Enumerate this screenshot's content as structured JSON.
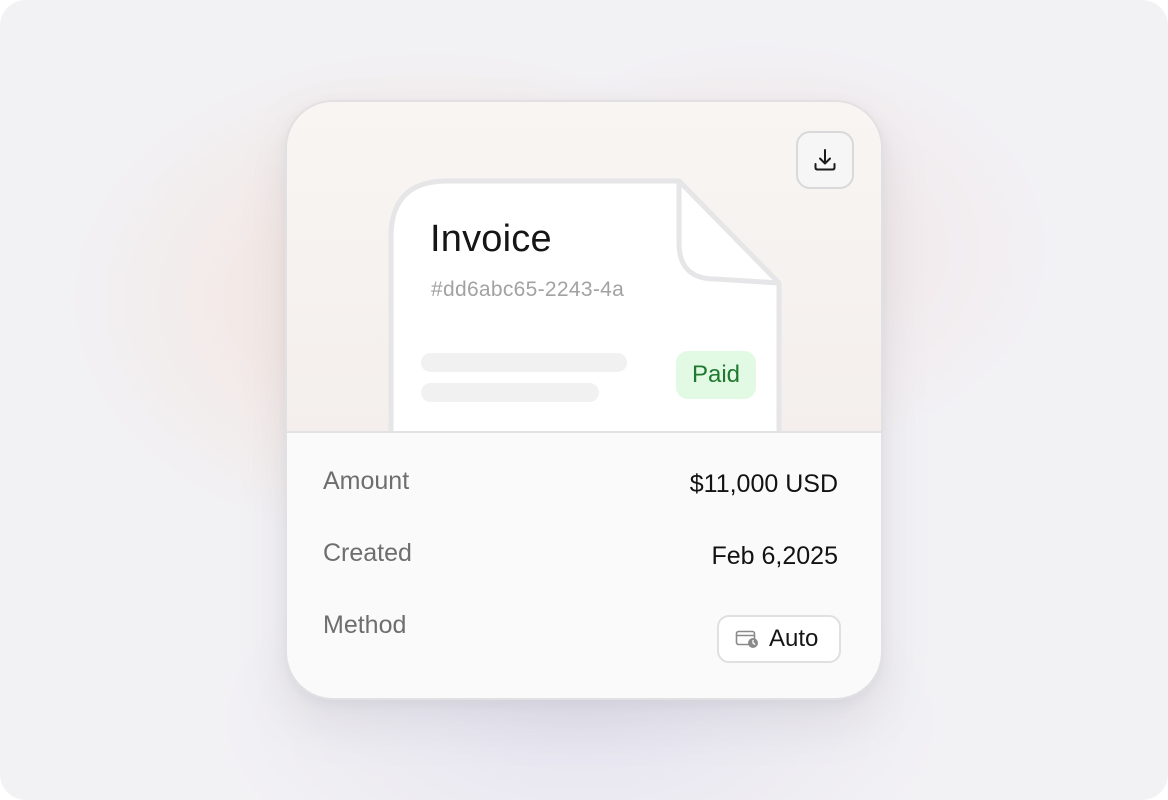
{
  "invoice": {
    "title": "Invoice",
    "id": "#dd6abc65-2243-4a",
    "status": "Paid",
    "download_icon": "download-icon"
  },
  "details": {
    "amount_label": "Amount",
    "amount_value": "$11,000 USD",
    "created_label": "Created",
    "created_value": "Feb 6,2025",
    "method_label": "Method",
    "method_value": "Auto",
    "method_icon": "card-clock-icon"
  },
  "colors": {
    "paid_bg": "#e2f9e4",
    "paid_text": "#1f7a2f",
    "card_border": "#e1e0e2"
  }
}
